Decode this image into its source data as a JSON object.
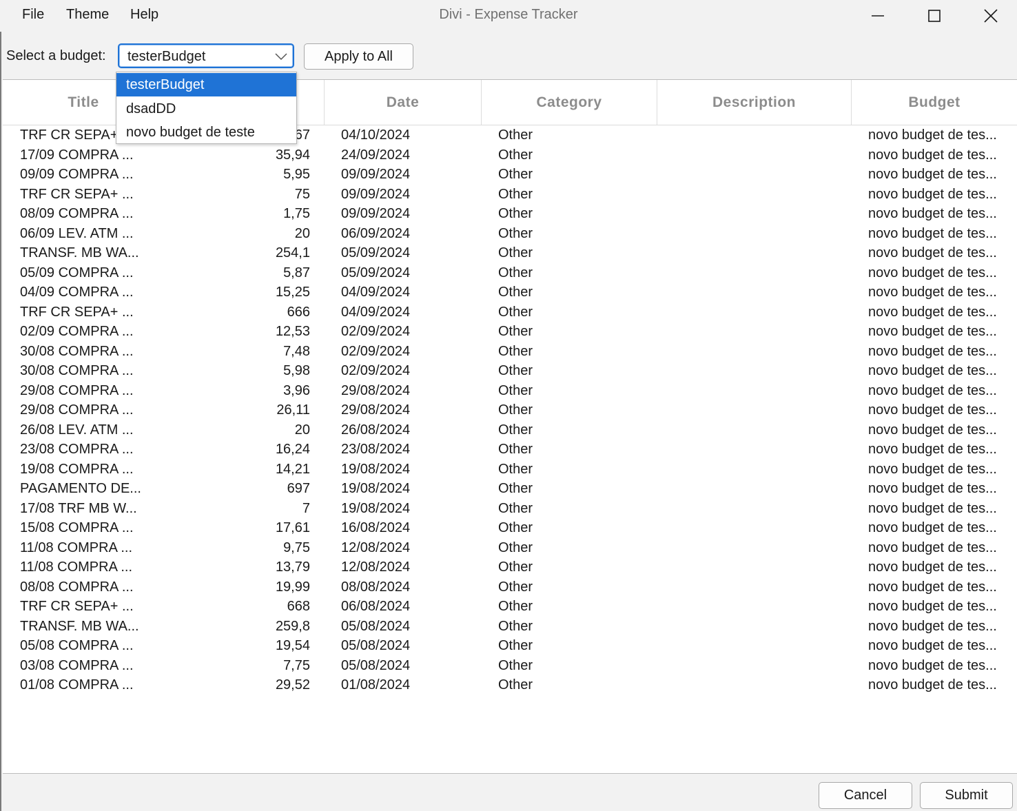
{
  "window": {
    "title": "Divi - Expense Tracker",
    "menu": [
      "File",
      "Theme",
      "Help"
    ],
    "controls": [
      "minimize-icon",
      "maximize-icon",
      "close-icon"
    ]
  },
  "toolbar": {
    "select_label": "Select a budget:",
    "selected_budget": "testerBudget",
    "apply_label": "Apply to All"
  },
  "dropdown": {
    "options": [
      "testerBudget",
      "dsadDD",
      "novo budget de teste"
    ],
    "highlighted": "testerBudget"
  },
  "table": {
    "columns": [
      "Title",
      "",
      "Date",
      "Category",
      "Description",
      "Budget"
    ],
    "rows": [
      {
        "title": "TRF CR SEPA+ ...",
        "amount": "67",
        "date": "04/10/2024",
        "category": "Other",
        "description": "",
        "budget": "novo budget de tes..."
      },
      {
        "title": "17/09 COMPRA ...",
        "amount": "35,94",
        "date": "24/09/2024",
        "category": "Other",
        "description": "",
        "budget": "novo budget de tes..."
      },
      {
        "title": "09/09 COMPRA ...",
        "amount": "5,95",
        "date": "09/09/2024",
        "category": "Other",
        "description": "",
        "budget": "novo budget de tes..."
      },
      {
        "title": "TRF CR SEPA+ ...",
        "amount": "75",
        "date": "09/09/2024",
        "category": "Other",
        "description": "",
        "budget": "novo budget de tes..."
      },
      {
        "title": "08/09 COMPRA ...",
        "amount": "1,75",
        "date": "09/09/2024",
        "category": "Other",
        "description": "",
        "budget": "novo budget de tes..."
      },
      {
        "title": "06/09 LEV. ATM ...",
        "amount": "20",
        "date": "06/09/2024",
        "category": "Other",
        "description": "",
        "budget": "novo budget de tes..."
      },
      {
        "title": "TRANSF. MB WA...",
        "amount": "254,1",
        "date": "05/09/2024",
        "category": "Other",
        "description": "",
        "budget": "novo budget de tes..."
      },
      {
        "title": "05/09 COMPRA ...",
        "amount": "5,87",
        "date": "05/09/2024",
        "category": "Other",
        "description": "",
        "budget": "novo budget de tes..."
      },
      {
        "title": "04/09 COMPRA ...",
        "amount": "15,25",
        "date": "04/09/2024",
        "category": "Other",
        "description": "",
        "budget": "novo budget de tes..."
      },
      {
        "title": "TRF CR SEPA+ ...",
        "amount": "666",
        "date": "04/09/2024",
        "category": "Other",
        "description": "",
        "budget": "novo budget de tes..."
      },
      {
        "title": "02/09 COMPRA ...",
        "amount": "12,53",
        "date": "02/09/2024",
        "category": "Other",
        "description": "",
        "budget": "novo budget de tes..."
      },
      {
        "title": "30/08 COMPRA ...",
        "amount": "7,48",
        "date": "02/09/2024",
        "category": "Other",
        "description": "",
        "budget": "novo budget de tes..."
      },
      {
        "title": "30/08 COMPRA ...",
        "amount": "5,98",
        "date": "02/09/2024",
        "category": "Other",
        "description": "",
        "budget": "novo budget de tes..."
      },
      {
        "title": "29/08 COMPRA ...",
        "amount": "3,96",
        "date": "29/08/2024",
        "category": "Other",
        "description": "",
        "budget": "novo budget de tes..."
      },
      {
        "title": "29/08 COMPRA ...",
        "amount": "26,11",
        "date": "29/08/2024",
        "category": "Other",
        "description": "",
        "budget": "novo budget de tes..."
      },
      {
        "title": "26/08 LEV. ATM ...",
        "amount": "20",
        "date": "26/08/2024",
        "category": "Other",
        "description": "",
        "budget": "novo budget de tes..."
      },
      {
        "title": "23/08 COMPRA ...",
        "amount": "16,24",
        "date": "23/08/2024",
        "category": "Other",
        "description": "",
        "budget": "novo budget de tes..."
      },
      {
        "title": "19/08 COMPRA ...",
        "amount": "14,21",
        "date": "19/08/2024",
        "category": "Other",
        "description": "",
        "budget": "novo budget de tes..."
      },
      {
        "title": "PAGAMENTO DE...",
        "amount": "697",
        "date": "19/08/2024",
        "category": "Other",
        "description": "",
        "budget": "novo budget de tes..."
      },
      {
        "title": "17/08 TRF MB W...",
        "amount": "7",
        "date": "19/08/2024",
        "category": "Other",
        "description": "",
        "budget": "novo budget de tes..."
      },
      {
        "title": "15/08 COMPRA ...",
        "amount": "17,61",
        "date": "16/08/2024",
        "category": "Other",
        "description": "",
        "budget": "novo budget de tes..."
      },
      {
        "title": "11/08 COMPRA ...",
        "amount": "9,75",
        "date": "12/08/2024",
        "category": "Other",
        "description": "",
        "budget": "novo budget de tes..."
      },
      {
        "title": "11/08 COMPRA ...",
        "amount": "13,79",
        "date": "12/08/2024",
        "category": "Other",
        "description": "",
        "budget": "novo budget de tes..."
      },
      {
        "title": "08/08 COMPRA ...",
        "amount": "19,99",
        "date": "08/08/2024",
        "category": "Other",
        "description": "",
        "budget": "novo budget de tes..."
      },
      {
        "title": "TRF CR SEPA+ ...",
        "amount": "668",
        "date": "06/08/2024",
        "category": "Other",
        "description": "",
        "budget": "novo budget de tes..."
      },
      {
        "title": "TRANSF. MB WA...",
        "amount": "259,8",
        "date": "05/08/2024",
        "category": "Other",
        "description": "",
        "budget": "novo budget de tes..."
      },
      {
        "title": "05/08 COMPRA ...",
        "amount": "19,54",
        "date": "05/08/2024",
        "category": "Other",
        "description": "",
        "budget": "novo budget de tes..."
      },
      {
        "title": "03/08 COMPRA ...",
        "amount": "7,75",
        "date": "05/08/2024",
        "category": "Other",
        "description": "",
        "budget": "novo budget de tes..."
      },
      {
        "title": "01/08 COMPRA ...",
        "amount": "29,52",
        "date": "01/08/2024",
        "category": "Other",
        "description": "",
        "budget": "novo budget de tes..."
      }
    ]
  },
  "footer": {
    "cancel_label": "Cancel",
    "submit_label": "Submit"
  },
  "colors": {
    "accent": "#1f73d6",
    "header_text": "#8c8c8c"
  }
}
